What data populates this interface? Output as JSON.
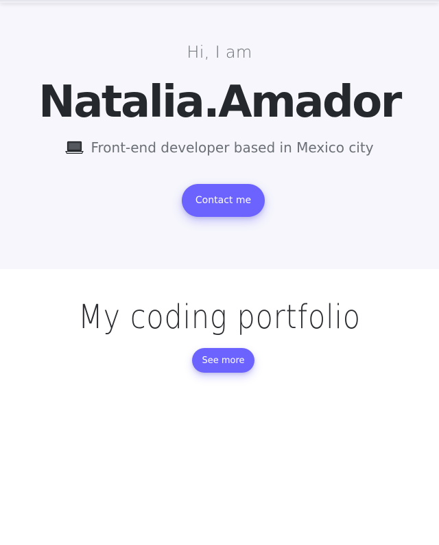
{
  "hero": {
    "greeting": "Hi, I am",
    "name": "Natalia.Amador",
    "tagline_icon": "laptop-icon",
    "tagline": "Front-end developer based in Mexico city",
    "contact_label": "Contact me"
  },
  "portfolio": {
    "title": "My coding portfolio",
    "see_more_label": "See more"
  },
  "colors": {
    "accent": "#6c63ff",
    "hero_background": "#f6f6fc",
    "heading_text": "#25282c",
    "muted_text": "#6b6f76"
  }
}
